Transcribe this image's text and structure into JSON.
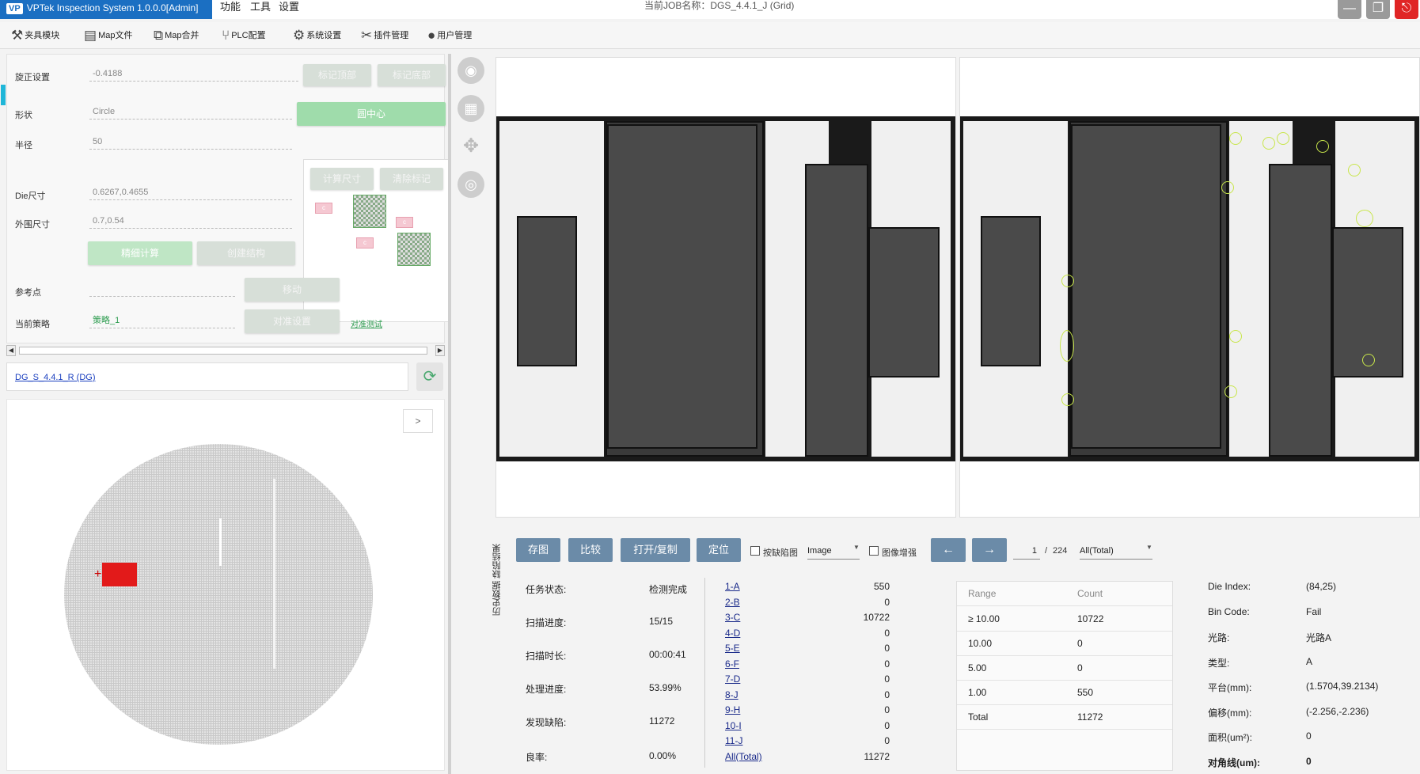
{
  "titlebar": {
    "app_title": "VPTek Inspection System 1.0.0.0[Admin]",
    "logo": "VP",
    "menus": [
      "功能",
      "工具",
      "设置"
    ],
    "job_title": "当前JOB名称：DGS_4.4.1_J (Grid)",
    "colors": {
      "title_bg": "#1b6fc2",
      "window_btn": "#9a9a9a",
      "close_btn": "#e02525"
    }
  },
  "toolbar": {
    "items": [
      {
        "label": "夹具模块",
        "icon": "wrench-icon"
      },
      {
        "label": "Map文件",
        "icon": "document-icon"
      },
      {
        "label": "Map合并",
        "icon": "merge-icon"
      },
      {
        "label": "PLC配置",
        "icon": "plc-icon"
      },
      {
        "label": "系统设置",
        "icon": "gear-icon"
      },
      {
        "label": "插件管理",
        "icon": "tools-icon"
      },
      {
        "label": "用户管理",
        "icon": "user-icon"
      }
    ]
  },
  "left_panel": {
    "rotation_label": "旋正设置",
    "rotation_value": "-0.4188",
    "mark_top": "标记顶部",
    "mark_bottom": "标记底部",
    "shape_label": "形状",
    "shape_value": "Circle",
    "center_btn": "圆中心",
    "radius_label": "半径",
    "radius_value": "50",
    "calc_size_btn": "计算尺寸",
    "clear_mark_btn": "清除标记",
    "die_size_label": "Die尺寸",
    "die_size_value": "0.6267,0.4655",
    "outer_size_label": "外围尺寸",
    "outer_size_value": "0.7,0.54",
    "fine_calc_btn": "精细计算",
    "create_struct_btn": "创建结构",
    "ref_point_label": "参考点",
    "move_btn": "移动",
    "strategy_label": "当前策略",
    "strategy_value": "策略_1",
    "align_btn": "对准设置",
    "align_test_link": "对准测试",
    "preview_c": "c"
  },
  "recipe": {
    "name": "DG_S_4.4.1_R (DG)"
  },
  "wafermap": {
    "expand_btn": ">"
  },
  "bottom_toolbar": {
    "save_btn": "存图",
    "compare_btn": "比较",
    "open_copy_btn": "打开/复制",
    "locate_btn": "定位",
    "defect_cb": "按缺陷图",
    "image_select": "Image",
    "enhance_cb": "图像增强",
    "prev_btn": "←",
    "next_btn": "→",
    "page_current": "1",
    "page_sep": "/",
    "page_total": "224",
    "filter_select": "All(Total)"
  },
  "side_tabs": {
    "history": "历史数据",
    "defect": "缺陷结果"
  },
  "stats": {
    "task_status_label": "任务状态:",
    "task_status": "检测完成",
    "scan_progress_label": "扫描进度:",
    "scan_progress": "15/15",
    "scan_time_label": "扫描时长:",
    "scan_time": "00:00:41",
    "proc_progress_label": "处理进度:",
    "proc_progress": "53.99%",
    "defects_label": "发现缺陷:",
    "defects": "11272",
    "yield_label": "良率:",
    "yield": "0.00%"
  },
  "bins": [
    {
      "name": "1-A",
      "count": "550"
    },
    {
      "name": "2-B",
      "count": "0"
    },
    {
      "name": "3-C",
      "count": "10722"
    },
    {
      "name": "4-D",
      "count": "0"
    },
    {
      "name": "5-E",
      "count": "0"
    },
    {
      "name": "6-F",
      "count": "0"
    },
    {
      "name": "7-D",
      "count": "0"
    },
    {
      "name": "8-J",
      "count": "0"
    },
    {
      "name": "9-H",
      "count": "0"
    },
    {
      "name": "10-I",
      "count": "0"
    },
    {
      "name": "11-J",
      "count": "0"
    },
    {
      "name": "All(Total)",
      "count": "11272"
    }
  ],
  "range_table": {
    "headers": [
      "Range",
      "Count"
    ],
    "rows": [
      {
        "range": "≥ 10.00",
        "count": "10722"
      },
      {
        "range": "10.00",
        "count": "0"
      },
      {
        "range": "5.00",
        "count": "0"
      },
      {
        "range": "1.00",
        "count": "550"
      },
      {
        "range": "Total",
        "count": "11272"
      }
    ]
  },
  "die_info": {
    "die_index_label": "Die Index:",
    "die_index": "(84,25)",
    "bin_code_label": "Bin Code:",
    "bin_code": "Fail",
    "light_label": "光路:",
    "light": "光路A",
    "type_label": "类型:",
    "type": "A",
    "platform_label": "平台(mm):",
    "platform": "(1.5704,39.2134)",
    "offset_label": "偏移(mm):",
    "offset": "(-2.256,-2.236)",
    "area_label": "面积(um²):",
    "area": "0",
    "diag_label": "对角线(um):",
    "diag": "0"
  }
}
